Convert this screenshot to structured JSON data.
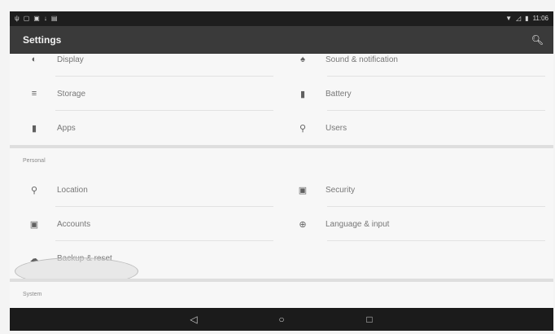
{
  "status_bar": {
    "left_icons": [
      "usb-icon",
      "screenshot-icon",
      "image-icon",
      "download-icon",
      "shopping-bag-icon"
    ],
    "right_icons": [
      "wifi-icon",
      "signal-icon",
      "battery-icon"
    ],
    "time": "11:06"
  },
  "toolbar": {
    "title": "Settings",
    "search_icon": "search-icon"
  },
  "device_items": [
    {
      "label": "Display",
      "icon": "display-icon"
    },
    {
      "label": "Sound & notification",
      "icon": "bell-icon"
    },
    {
      "label": "Storage",
      "icon": "storage-icon"
    },
    {
      "label": "Battery",
      "icon": "battery-icon"
    },
    {
      "label": "Apps",
      "icon": "apps-icon"
    },
    {
      "label": "Users",
      "icon": "user-icon"
    }
  ],
  "personal": {
    "header": "Personal",
    "items": [
      {
        "label": "Location",
        "icon": "location-icon"
      },
      {
        "label": "Security",
        "icon": "lock-icon"
      },
      {
        "label": "Accounts",
        "icon": "account-icon"
      },
      {
        "label": "Language & input",
        "icon": "globe-icon"
      },
      {
        "label": "Backup & reset",
        "icon": "backup-icon"
      }
    ]
  },
  "system": {
    "header": "System"
  },
  "nav_bar": {
    "back": "◁",
    "home": "○",
    "recents": "□"
  }
}
